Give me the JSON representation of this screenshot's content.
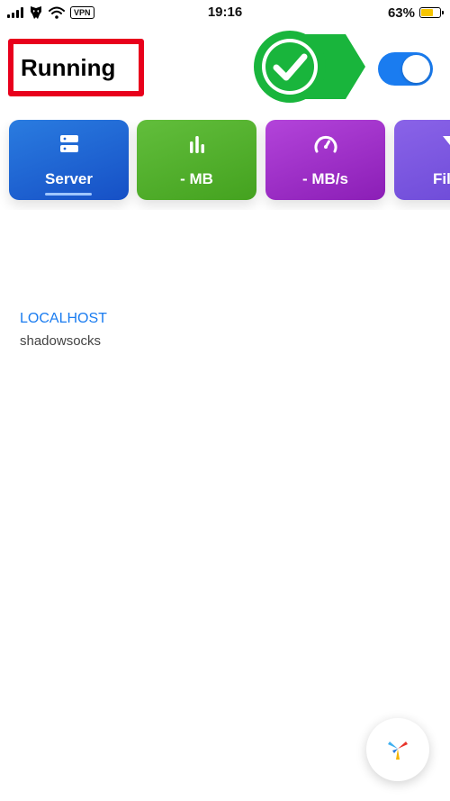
{
  "status_bar": {
    "time": "19:16",
    "vpn_label": "VPN",
    "battery_percent": "63%",
    "battery_level": 0.63,
    "battery_color": "#f6c500"
  },
  "header": {
    "status_text": "Running",
    "annotation_color": "#19b53c",
    "highlight_color": "#e8001c",
    "toggle_on": true,
    "toggle_color": "#1a7cf0"
  },
  "cards": [
    {
      "label": "Server",
      "icon": "server-icon",
      "active": true
    },
    {
      "label": "- MB",
      "icon": "bar-chart-icon",
      "active": false
    },
    {
      "label": "- MB/s",
      "icon": "speedometer-icon",
      "active": false
    },
    {
      "label": "Fil",
      "icon": "filter-icon",
      "active": false
    }
  ],
  "server_list": [
    {
      "name": "LOCALHOST",
      "type": "shadowsocks"
    }
  ],
  "fab": {
    "icon": "app-logo-icon"
  }
}
